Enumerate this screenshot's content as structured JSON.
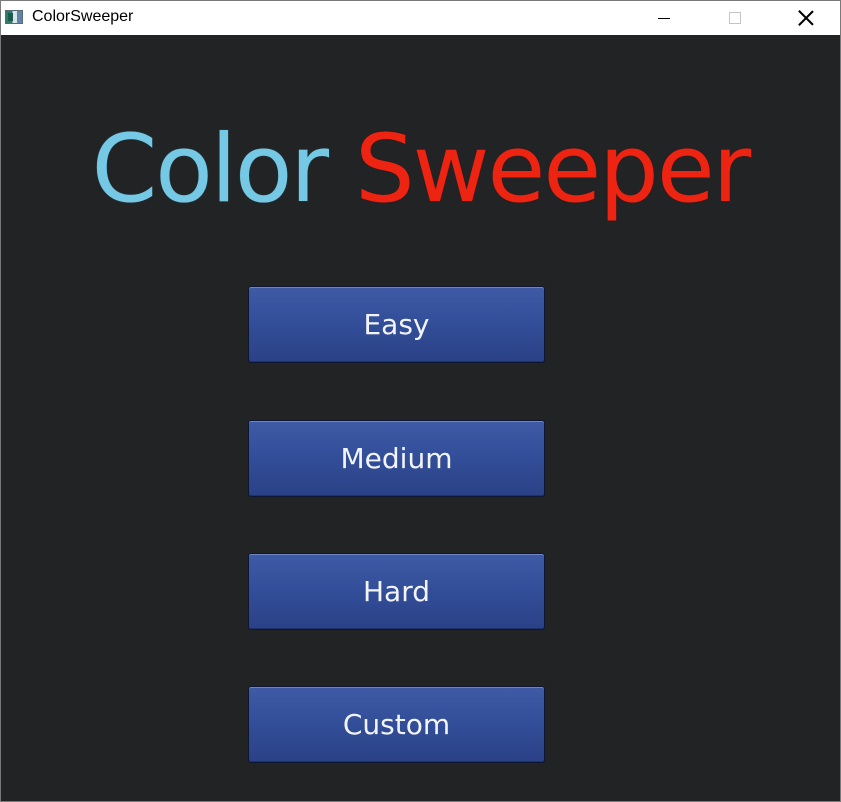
{
  "window": {
    "title": "ColorSweeper",
    "controls": {
      "minimize": "minimize-icon",
      "maximize": "maximize-icon",
      "close": "close-icon"
    }
  },
  "game": {
    "title_part1": "Color",
    "title_part2": "Sweeper",
    "colors": {
      "background": "#222324",
      "title_part1": "#76c9e4",
      "title_part2": "#ee2413",
      "button": "#334f9a",
      "button_text": "#f2f4fa"
    }
  },
  "menu": {
    "easy_label": "Easy",
    "medium_label": "Medium",
    "hard_label": "Hard",
    "custom_label": "Custom"
  }
}
